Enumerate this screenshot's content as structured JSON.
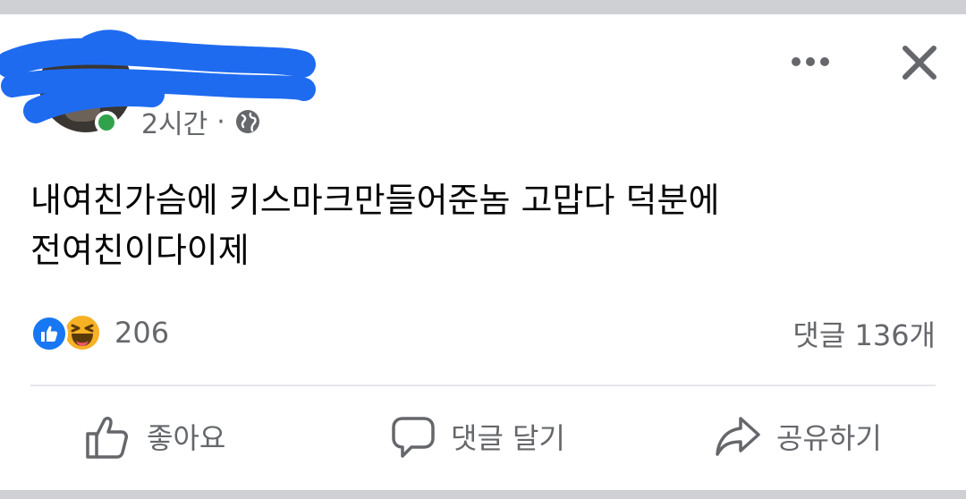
{
  "post": {
    "time": "2시간",
    "separator": "·",
    "privacy_icon": "globe-icon",
    "text_lines": [
      "내여친가슴에 키스마크만들어준놈 고맙다 덕분에",
      "전여친이다이제"
    ]
  },
  "header": {
    "more_icon": "more-dots-icon",
    "close_icon": "close-icon"
  },
  "stats": {
    "reaction_icons": [
      "like-icon",
      "haha-icon"
    ],
    "reaction_count": "206",
    "comment_count": "댓글 136개"
  },
  "actions": {
    "like_label": "좋아요",
    "comment_label": "댓글 달기",
    "share_label": "공유하기"
  },
  "colors": {
    "like_blue": "#1877f2",
    "haha_yellow": "#f7b125",
    "online_green": "#31a24c",
    "redaction_blue": "#1f6bf0",
    "secondary_text": "#65676b"
  }
}
